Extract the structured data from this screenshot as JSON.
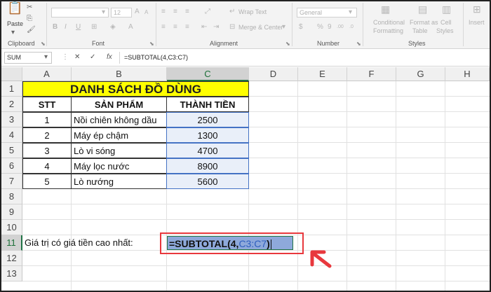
{
  "ribbon": {
    "clipboard": {
      "paste_label": "Paste",
      "group_label": "Clipboard"
    },
    "font": {
      "family": "",
      "size": "12",
      "bold": "B",
      "italic": "I",
      "underline": "U",
      "grow": "A",
      "shrink": "A",
      "color_a": "A",
      "group_label": "Font"
    },
    "alignment": {
      "wrap_text": "Wrap Text",
      "merge_center": "Merge & Center",
      "group_label": "Alignment"
    },
    "number": {
      "format": "General",
      "currency": "$",
      "percent": "%",
      "comma": "9",
      "inc_dec": ".00",
      "dec_dec": ".0",
      "group_label": "Number"
    },
    "styles": {
      "conditional": "Conditional",
      "conditional2": "Formatting",
      "format_as": "Format as",
      "format_as2": "Table",
      "cell": "Cell",
      "cell2": "Styles",
      "group_label": "Styles"
    },
    "cells": {
      "insert": "Insert"
    }
  },
  "formula_bar": {
    "name_box": "SUM",
    "cancel": "✕",
    "enter": "✓",
    "fx": "fx",
    "formula": "=SUBTOTAL(4,C3:C7)"
  },
  "columns": [
    "A",
    "B",
    "C",
    "D",
    "E",
    "F",
    "G",
    "H"
  ],
  "rows": [
    "1",
    "2",
    "3",
    "4",
    "5",
    "6",
    "7",
    "8",
    "9",
    "10",
    "11",
    "12",
    "13"
  ],
  "sheet": {
    "title": "DANH SÁCH ĐỒ DÙNG",
    "headers": {
      "stt": "STT",
      "product": "SẢN PHẨM",
      "amount": "THÀNH TIỀN"
    },
    "items": [
      {
        "stt": "1",
        "product": "Nồi chiên không dầu",
        "amount": "2500"
      },
      {
        "stt": "2",
        "product": "Máy ép chậm",
        "amount": "1300"
      },
      {
        "stt": "3",
        "product": "Lò vi sóng",
        "amount": "4700"
      },
      {
        "stt": "4",
        "product": "Máy lọc nước",
        "amount": "8900"
      },
      {
        "stt": "5",
        "product": "Lò nướng",
        "amount": "5600"
      }
    ],
    "label_row11": "Giá trị có giá tiền cao nhất:",
    "edit_formula_prefix": "=SUBTOTAL(4,",
    "edit_formula_ref": "C3:C7",
    "edit_formula_suffix": ")"
  },
  "colors": {
    "title_fill": "#ffff00",
    "header_green": "#217346",
    "ref_blue": "#4472c4",
    "arrow_red": "#e8383d",
    "cell_highlight": "#8ea9db"
  }
}
